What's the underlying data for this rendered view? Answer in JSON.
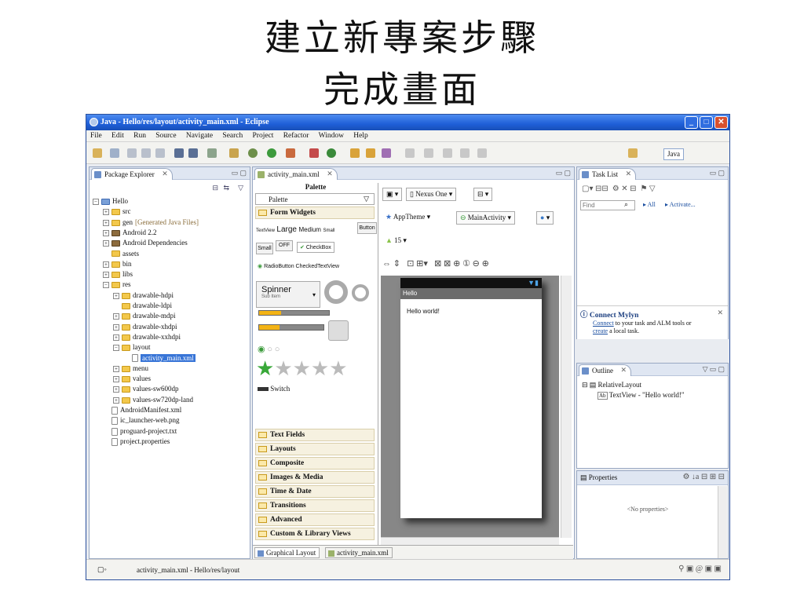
{
  "slide": {
    "title_line1": "建立新專案步驟",
    "title_line2": "完成畫面"
  },
  "window": {
    "title": "Java - Hello/res/layout/activity_main.xml - Eclipse",
    "minimize": "_",
    "maximize": "□",
    "close": "✕"
  },
  "menu": [
    "File",
    "Edit",
    "Run",
    "Source",
    "Navigate",
    "Search",
    "Project",
    "Refactor",
    "Window",
    "Help"
  ],
  "toolbar": {
    "perspective": "Java"
  },
  "package_explorer": {
    "tab": "Package Explorer",
    "close": "✕",
    "tree": [
      {
        "label": "Hello",
        "indent": 0,
        "exp": "−",
        "icon": "proj"
      },
      {
        "label": "src",
        "indent": 1,
        "exp": "+",
        "icon": "folder"
      },
      {
        "label": "gen",
        "extra": "[Generated Java Files]",
        "indent": 1,
        "exp": "+",
        "icon": "folder"
      },
      {
        "label": "Android 2.2",
        "indent": 1,
        "exp": "+",
        "icon": "lib"
      },
      {
        "label": "Android Dependencies",
        "indent": 1,
        "exp": "+",
        "icon": "lib"
      },
      {
        "label": "assets",
        "indent": 1,
        "exp": "",
        "icon": "folder"
      },
      {
        "label": "bin",
        "indent": 1,
        "exp": "+",
        "icon": "folder"
      },
      {
        "label": "libs",
        "indent": 1,
        "exp": "+",
        "icon": "folder"
      },
      {
        "label": "res",
        "indent": 1,
        "exp": "−",
        "icon": "folder"
      },
      {
        "label": "drawable-hdpi",
        "indent": 2,
        "exp": "+",
        "icon": "folder"
      },
      {
        "label": "drawable-ldpi",
        "indent": 2,
        "exp": "",
        "icon": "folder"
      },
      {
        "label": "drawable-mdpi",
        "indent": 2,
        "exp": "+",
        "icon": "folder"
      },
      {
        "label": "drawable-xhdpi",
        "indent": 2,
        "exp": "+",
        "icon": "folder"
      },
      {
        "label": "drawable-xxhdpi",
        "indent": 2,
        "exp": "+",
        "icon": "folder"
      },
      {
        "label": "layout",
        "indent": 2,
        "exp": "−",
        "icon": "folder"
      },
      {
        "label": "activity_main.xml",
        "indent": 3,
        "exp": "",
        "icon": "file",
        "selected": true
      },
      {
        "label": "menu",
        "indent": 2,
        "exp": "+",
        "icon": "folder"
      },
      {
        "label": "values",
        "indent": 2,
        "exp": "+",
        "icon": "folder"
      },
      {
        "label": "values-sw600dp",
        "indent": 2,
        "exp": "+",
        "icon": "folder"
      },
      {
        "label": "values-sw720dp-land",
        "indent": 2,
        "exp": "+",
        "icon": "folder"
      },
      {
        "label": "AndroidManifest.xml",
        "indent": 1,
        "exp": "",
        "icon": "file"
      },
      {
        "label": "ic_launcher-web.png",
        "indent": 1,
        "exp": "",
        "icon": "file"
      },
      {
        "label": "proguard-project.txt",
        "indent": 1,
        "exp": "",
        "icon": "file"
      },
      {
        "label": "project.properties",
        "indent": 1,
        "exp": "",
        "icon": "file"
      }
    ]
  },
  "editor": {
    "tab": "activity_main.xml",
    "palette_header": "Palette",
    "palette_select": "Palette",
    "form_widgets": "Form Widgets",
    "widgets": {
      "textview": "TextView",
      "large": "Large",
      "medium": "Medium",
      "small": "Small",
      "button": "Button",
      "small_btn": "Small",
      "off": "OFF",
      "checkbox": "CheckBox",
      "radio": "RadioButton",
      "checkedtext": "CheckedTextView",
      "spinner": "Spinner",
      "spinner_sub": "Sub Item",
      "switch": "Switch"
    },
    "categories": [
      "Text Fields",
      "Layouts",
      "Composite",
      "Images & Media",
      "Time & Date",
      "Transitions",
      "Advanced",
      "Custom & Library Views"
    ],
    "design_toolbar": {
      "device": "Nexus One",
      "theme": "AppTheme",
      "activity": "MainActivity",
      "api": "15"
    },
    "device_preview": {
      "action_bar": "Hello",
      "content": "Hello world!"
    },
    "bottom_tabs": [
      "Graphical Layout",
      "activity_main.xml"
    ]
  },
  "task_list": {
    "tab": "Task List",
    "close": "✕",
    "find_placeholder": "Find",
    "all": "All",
    "activate": "Activate..."
  },
  "mylyn": {
    "title": "Connect Mylyn",
    "link1": "Connect",
    "text1": " to your task and ALM tools or",
    "link2": "create",
    "text2": " a local task.",
    "close": "✕"
  },
  "outline": {
    "tab": "Outline",
    "close": "✕",
    "root": "RelativeLayout",
    "child_tag": "Ab",
    "child": "TextView - \"Hello world!\""
  },
  "properties": {
    "tab": "Properties",
    "empty": "<No properties>"
  },
  "status": {
    "text": "activity_main.xml - Hello/res/layout"
  }
}
